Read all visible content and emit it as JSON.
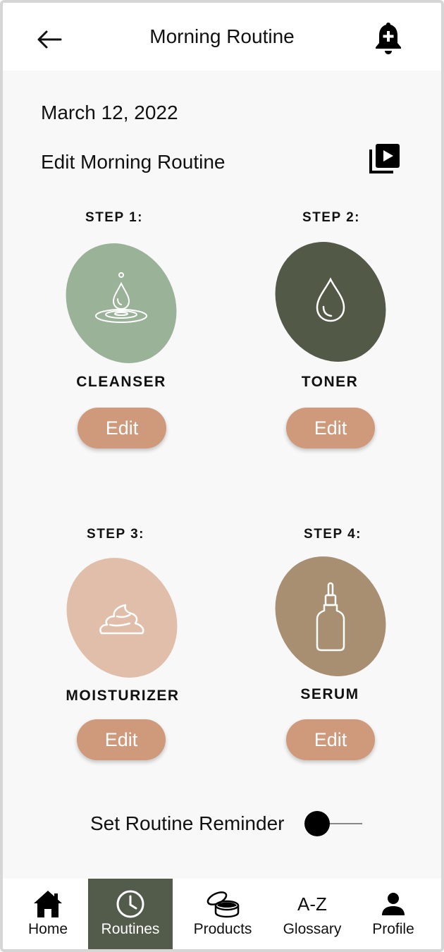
{
  "header": {
    "title": "Morning Routine",
    "back_icon": "arrow-left-icon",
    "bell_icon": "bell-plus-icon"
  },
  "date": "March 12, 2022",
  "edit_routine_label": "Edit Morning Routine",
  "video_icon": "video-library-icon",
  "steps": [
    {
      "label": "STEP 1:",
      "name": "CLEANSER",
      "edit": "Edit",
      "color": "#9ab297",
      "icon": "water-drop-ripple-icon"
    },
    {
      "label": "STEP 2:",
      "name": "TONER",
      "edit": "Edit",
      "color": "#525947",
      "icon": "water-drop-icon"
    },
    {
      "label": "STEP 3:",
      "name": "MOISTURIZER",
      "edit": "Edit",
      "color": "#e1bea9",
      "icon": "cream-icon"
    },
    {
      "label": "STEP 4:",
      "name": "SERUM",
      "edit": "Edit",
      "color": "#a88f72",
      "icon": "dropper-bottle-icon"
    }
  ],
  "reminder": {
    "label": "Set Routine Reminder",
    "enabled": false
  },
  "nav": [
    {
      "label": "Home",
      "icon": "home-icon",
      "active": false
    },
    {
      "label": "Routines",
      "icon": "clock-icon",
      "active": true
    },
    {
      "label": "Products",
      "icon": "cream-jar-icon",
      "active": false
    },
    {
      "label": "Glossary",
      "icon": "A-Z",
      "active": false
    },
    {
      "label": "Profile",
      "icon": "person-icon",
      "active": false
    }
  ],
  "colors": {
    "accent": "#cf9a7b",
    "nav_active": "#535c4b",
    "background": "#f8f8f8"
  }
}
